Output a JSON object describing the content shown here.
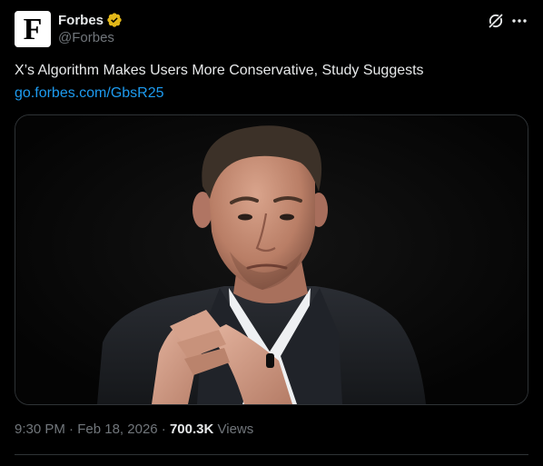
{
  "author": {
    "display_name": "Forbes",
    "handle": "@Forbes",
    "avatar_letter": "F",
    "verified": "gold",
    "verified_color": "#e2b719"
  },
  "actions": {
    "grok_icon": "grok-icon",
    "more_icon": "more-options-icon"
  },
  "post": {
    "text": "X’s Algorithm Makes Users More Conservative, Study Suggests",
    "link": "go.forbes.com/GbsR25"
  },
  "media": {
    "type": "photo"
  },
  "meta": {
    "time": "9:30 PM",
    "separator1": " · ",
    "date": "Feb 18, 2026",
    "separator2": " · ",
    "views_count": "700.3K",
    "views_label": " Views"
  },
  "colors": {
    "background": "#000000",
    "text_primary": "#e7e9ea",
    "text_secondary": "#71767b",
    "link": "#1d9bf0",
    "border": "#2f3336"
  }
}
